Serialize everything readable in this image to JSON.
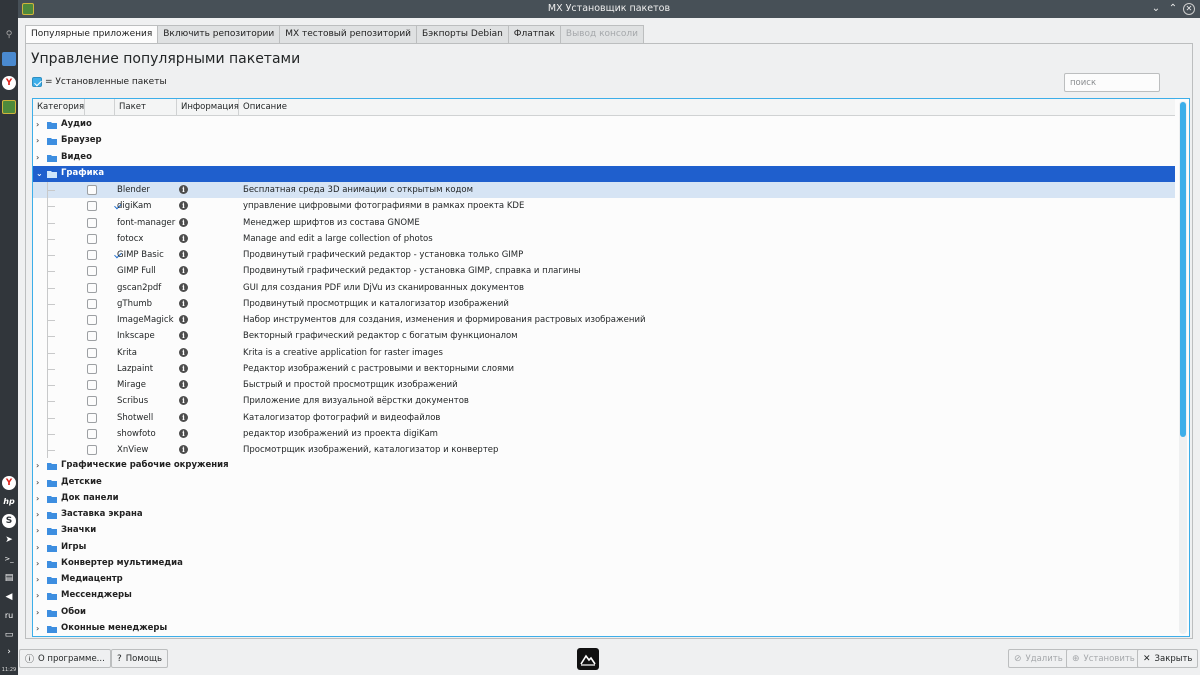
{
  "window": {
    "title": "MX Установщик пакетов"
  },
  "taskbar": {
    "icons": [
      "search-icon",
      "files-icon",
      "yandex-browser-icon",
      "package-installer-icon",
      "yandex-icon",
      "hp-icon",
      "skype-icon",
      "telegram-icon",
      "terminal-icon",
      "clipboard-icon",
      "volume-icon"
    ],
    "lang": "ru",
    "time": "11:29"
  },
  "tabs": [
    {
      "label": "Популярные приложения",
      "active": true
    },
    {
      "label": "Включить репозитории"
    },
    {
      "label": "MX тестовый репозиторий"
    },
    {
      "label": "Бэкпорты Debian"
    },
    {
      "label": "Флатпак"
    },
    {
      "label": "Вывод консоли",
      "disabled": true
    }
  ],
  "page": {
    "title": "Управление популярными пакетами",
    "installed_legend": "= Установленные пакеты",
    "search_placeholder": "поиск"
  },
  "tree": {
    "columns": [
      "Категория",
      "",
      "Пакет",
      "Информация",
      "Описание"
    ],
    "categories_before": [
      "Аудио",
      "Браузер",
      "Видео"
    ],
    "expanded_category": "Графика",
    "packages": [
      {
        "name": "Blender",
        "installed": false,
        "desc": "Бесплатная среда 3D анимации с открытым кодом"
      },
      {
        "name": "digiKam",
        "installed": true,
        "desc": "управление цифровыми фотографиями в рамках проекта KDE"
      },
      {
        "name": "font-manager",
        "installed": false,
        "desc": "Менеджер шрифтов из состава GNOME"
      },
      {
        "name": "fotocx",
        "installed": false,
        "desc": "Manage and edit a large collection of photos"
      },
      {
        "name": "GIMP Basic",
        "installed": true,
        "desc": "Продвинутый графический редактор - установка только GIMP"
      },
      {
        "name": "GIMP Full",
        "installed": false,
        "desc": "Продвинутый графический редактор - установка GIMP, справка и плагины"
      },
      {
        "name": "gscan2pdf",
        "installed": false,
        "desc": "GUI для создания PDF или DjVu из сканированных документов"
      },
      {
        "name": "gThumb",
        "installed": false,
        "desc": "Продвинутый просмотрщик и каталогизатор изображений"
      },
      {
        "name": "ImageMagick",
        "installed": false,
        "desc": "Набор инструментов для создания, изменения и формирования растровых изображений"
      },
      {
        "name": "Inkscape",
        "installed": false,
        "desc": "Векторный графический редактор с богатым функционалом"
      },
      {
        "name": "Krita",
        "installed": false,
        "desc": "Krita is a creative application for raster images"
      },
      {
        "name": "Lazpaint",
        "installed": false,
        "desc": "Редактор изображений с растровыми и векторными слоями"
      },
      {
        "name": "Mirage",
        "installed": false,
        "desc": "Быстрый и простой просмотрщик изображений"
      },
      {
        "name": "Scribus",
        "installed": false,
        "desc": "Приложение для визуальной вёрстки документов"
      },
      {
        "name": "Shotwell",
        "installed": false,
        "desc": "Каталогизатор фотографий и видеофайлов"
      },
      {
        "name": "showfoto",
        "installed": false,
        "desc": "редактор изображений из проекта digiKam"
      },
      {
        "name": "XnView",
        "installed": false,
        "desc": "Просмотрщик изображений, каталогизатор и конвертер"
      }
    ],
    "categories_after": [
      "Графические рабочие окружения",
      "Детские",
      "Док панели",
      "Заставка экрана",
      "Значки",
      "Игры",
      "Конвертер мультимедиа",
      "Медиацентр",
      "Мессенджеры",
      "Обои",
      "Оконные менеджеры"
    ]
  },
  "buttons": {
    "about": "О программе...",
    "help": "Помощь",
    "remove": "Удалить",
    "install": "Установить",
    "close": "Закрыть"
  },
  "colors": {
    "accent": "#3daee9",
    "selection": "#1f5fcd",
    "titlebar": "#475057",
    "taskbar": "#31363b"
  }
}
